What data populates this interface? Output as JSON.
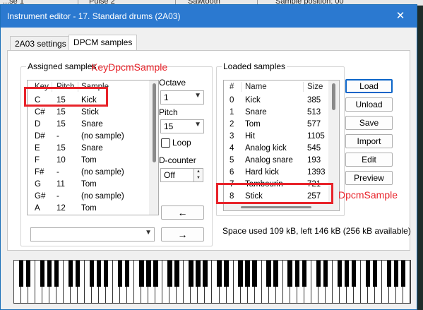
{
  "background_tabs": [
    "...se 1",
    "Pulse 2",
    "Sawtooth",
    "Sample position: 00"
  ],
  "window": {
    "title": "Instrument editor - 17. Standard drums (2A03)",
    "close_glyph": "✕"
  },
  "tabs": [
    {
      "label": "2A03 settings",
      "active": false
    },
    {
      "label": "DPCM samples",
      "active": true
    }
  ],
  "assigned": {
    "group_label": "Assigned samples",
    "columns": [
      "Key",
      "Pitch",
      "Sample"
    ],
    "rows": [
      [
        "C",
        "15",
        "Kick"
      ],
      [
        "C#",
        "15",
        "Stick"
      ],
      [
        "D",
        "15",
        "Snare"
      ],
      [
        "D#",
        "-",
        "(no sample)"
      ],
      [
        "E",
        "15",
        "Snare"
      ],
      [
        "F",
        "10",
        "Tom"
      ],
      [
        "F#",
        "-",
        "(no sample)"
      ],
      [
        "G",
        "11",
        "Tom"
      ],
      [
        "G#",
        "-",
        "(no sample)"
      ],
      [
        "A",
        "12",
        "Tom"
      ]
    ],
    "sample_select_value": ""
  },
  "controls": {
    "octave_label": "Octave",
    "octave_value": "1",
    "pitch_label": "Pitch",
    "pitch_value": "15",
    "loop_label": "Loop",
    "dcounter_label": "D-counter",
    "dcounter_value": "Off",
    "left_arrow": "←",
    "right_arrow": "→"
  },
  "loaded": {
    "group_label": "Loaded samples",
    "columns": [
      "#",
      "Name",
      "Size"
    ],
    "rows": [
      [
        "0",
        "Kick",
        "385"
      ],
      [
        "1",
        "Snare",
        "513"
      ],
      [
        "2",
        "Tom",
        "577"
      ],
      [
        "3",
        "Hit",
        "1105"
      ],
      [
        "4",
        "Analog kick",
        "545"
      ],
      [
        "5",
        "Analog snare",
        "193"
      ],
      [
        "6",
        "Hard kick",
        "1393"
      ],
      [
        "7",
        "Tambourin",
        "721"
      ],
      [
        "8",
        "Stick",
        "257"
      ]
    ],
    "buttons": [
      "Load",
      "Unload",
      "Save",
      "Import",
      "Edit",
      "Preview"
    ],
    "status": "Space used 109 kB, left 146 kB (256 kB available)"
  },
  "annotations": {
    "key_label": "KeyDpcmSample",
    "dpcm_label": "DpcmSample",
    "color": "#e8232a"
  },
  "piano": {
    "white_keys": 56
  }
}
